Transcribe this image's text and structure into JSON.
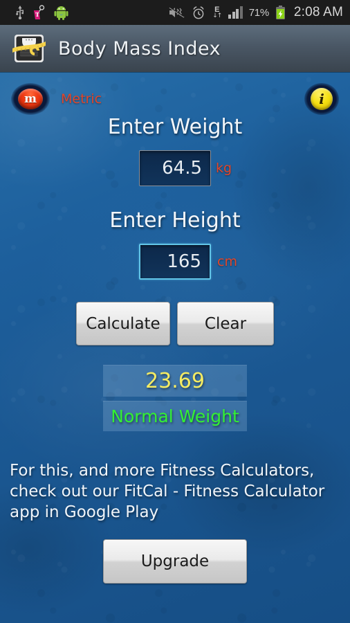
{
  "status_bar": {
    "icons_left": [
      "usb-icon",
      "tmobile-tag-icon",
      "android-robot-icon"
    ],
    "icons_right": [
      "mute-vibrate-off-icon",
      "alarm-clock-icon",
      "edge-data-icon",
      "signal-bars-icon"
    ],
    "signal_label": "E",
    "battery_percent": "71%",
    "battery_state": "charging",
    "time": "2:08 AM"
  },
  "title_bar": {
    "app_icon": "bathroom-scale-icon",
    "title": "Body Mass Index"
  },
  "unit_toggle": {
    "glyph": "m",
    "label": "Metric"
  },
  "info_button": {
    "glyph": "i"
  },
  "weight": {
    "label": "Enter Weight",
    "value": "64.5",
    "placeholder": "",
    "unit": "kg"
  },
  "height": {
    "label": "Enter Height",
    "value": "165",
    "placeholder": "",
    "unit": "cm"
  },
  "actions": {
    "calculate": "Calculate",
    "clear": "Clear",
    "upgrade": "Upgrade"
  },
  "result": {
    "bmi": "23.69",
    "category": "Normal Weight"
  },
  "promo": {
    "text": "For this, and more Fitness Calculators, check out our FitCal - Fitness Calculator app in Google Play"
  },
  "colors": {
    "accent_red": "#e2462a",
    "bmi_yellow": "#f4eb63",
    "category_green": "#33f033",
    "background_blue": "#1d5f9c",
    "titlebar_top": "#5d6d7c",
    "titlebar_bottom": "#3a444e",
    "focus_border": "#62c6e8"
  }
}
